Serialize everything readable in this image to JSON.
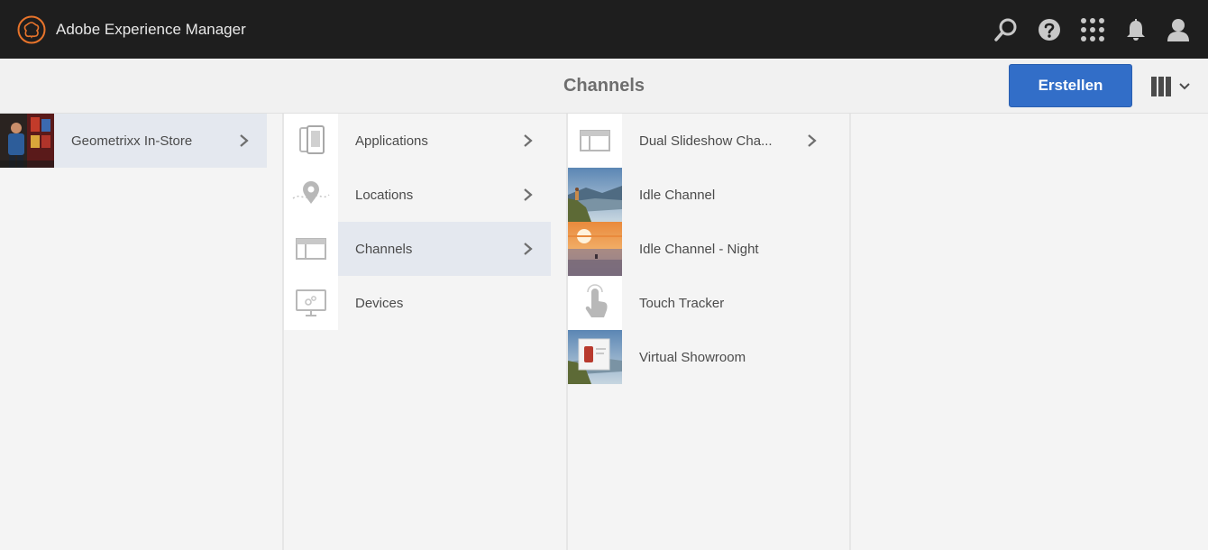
{
  "shell": {
    "title": "Adobe Experience Manager",
    "icons": [
      "search-icon",
      "help-icon",
      "apps-grid-icon",
      "notifications-bell-icon",
      "user-profile-icon"
    ]
  },
  "actionbar": {
    "title": "Channels",
    "create_label": "Erstellen",
    "view_icon": "column-view-icon"
  },
  "columns": [
    {
      "items": [
        {
          "label": "Geometrixx In-Store",
          "thumb": "store-photo",
          "has_children": true,
          "selected": true
        }
      ]
    },
    {
      "items": [
        {
          "label": "Applications",
          "thumb": "applications-icon",
          "has_children": true,
          "selected": false
        },
        {
          "label": "Locations",
          "thumb": "location-pin-icon",
          "has_children": true,
          "selected": false
        },
        {
          "label": "Channels",
          "thumb": "channel-layout-icon",
          "has_children": true,
          "selected": true
        },
        {
          "label": "Devices",
          "thumb": "device-monitor-icon",
          "has_children": false,
          "selected": false
        }
      ]
    },
    {
      "items": [
        {
          "label": "Dual Slideshow Cha...",
          "thumb": "channel-layout-icon",
          "has_children": true,
          "selected": false
        },
        {
          "label": "Idle Channel",
          "thumb": "mountain-photo",
          "has_children": false,
          "selected": false
        },
        {
          "label": "Idle Channel - Night",
          "thumb": "sunset-photo",
          "has_children": false,
          "selected": false
        },
        {
          "label": "Touch Tracker",
          "thumb": "touch-hand-icon",
          "has_children": false,
          "selected": false
        },
        {
          "label": "Virtual Showroom",
          "thumb": "showroom-photo",
          "has_children": false,
          "selected": false
        }
      ]
    }
  ],
  "colors": {
    "shell_bg": "#1e1e1e",
    "accent": "#326ec8",
    "selected_bg": "#e4e8ef"
  }
}
